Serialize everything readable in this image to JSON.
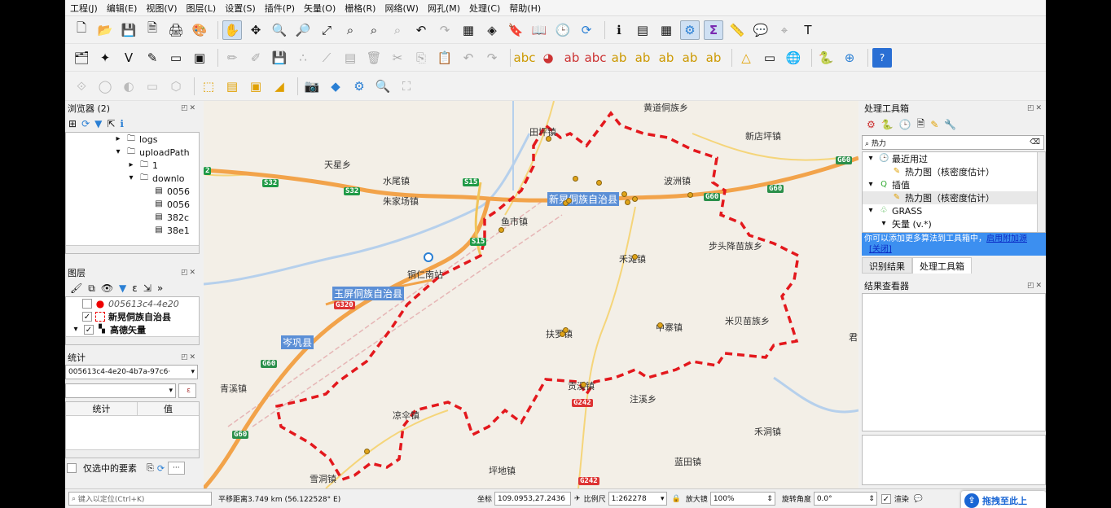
{
  "menu": [
    "工程(J)",
    "编辑(E)",
    "视图(V)",
    "图层(L)",
    "设置(S)",
    "插件(P)",
    "矢量(O)",
    "栅格(R)",
    "网络(W)",
    "网孔(M)",
    "处理(C)",
    "帮助(H)"
  ],
  "browser": {
    "title": "浏览器 (2)",
    "items": [
      "logs",
      "uploadPath",
      "1",
      "downlo",
      "0056",
      "0056",
      "382c",
      "38e1"
    ]
  },
  "layers": {
    "title": "图层",
    "items": [
      "005613c4-4e20",
      "新晃侗族自治县",
      "高德矢量"
    ]
  },
  "stats": {
    "title": "统计",
    "layer_value": "005613c4-4e20-4b7a-97c6·",
    "col_stat": "统计",
    "col_value": "值",
    "selected_only": "仅选中的要素",
    "more": "···"
  },
  "map": {
    "towns": [
      {
        "t": "天星乡"
      },
      {
        "t": "水尾镇"
      },
      {
        "t": "朱家场镇"
      },
      {
        "t": "田坪镇"
      },
      {
        "t": "新店坪镇"
      },
      {
        "t": "波洲镇"
      },
      {
        "t": "鱼市镇"
      },
      {
        "t": "步头降苗族乡"
      },
      {
        "t": "禾滩镇"
      },
      {
        "t": "铜仁南站"
      },
      {
        "t": "中寨镇"
      },
      {
        "t": "米贝苗族乡"
      },
      {
        "t": "扶罗镇"
      },
      {
        "t": "贡溪镇"
      },
      {
        "t": "注溪乡"
      },
      {
        "t": "青溪镇"
      },
      {
        "t": "凉伞镇"
      },
      {
        "t": "禾洞镇"
      },
      {
        "t": "蓝田镇"
      },
      {
        "t": "雪洞镇"
      },
      {
        "t": "坪地镇"
      },
      {
        "t": "黄道侗族乡"
      },
      {
        "t": "君"
      }
    ],
    "counties": [
      {
        "t": "新晃侗族自治县"
      },
      {
        "t": "玉屏侗族自治县"
      },
      {
        "t": "岑巩县"
      }
    ],
    "shields": [
      {
        "t": "S32",
        "c": "sh-s"
      },
      {
        "t": "S32",
        "c": "sh-s"
      },
      {
        "t": "S15",
        "c": "sh-s"
      },
      {
        "t": "S15",
        "c": "sh-s"
      },
      {
        "t": "G60",
        "c": "sh-g"
      },
      {
        "t": "G60",
        "c": "sh-g"
      },
      {
        "t": "G60",
        "c": "sh-g"
      },
      {
        "t": "G60",
        "c": "sh-g"
      },
      {
        "t": "G60",
        "c": "sh-g"
      },
      {
        "t": "G320",
        "c": "sh-r"
      },
      {
        "t": "G242",
        "c": "sh-r"
      },
      {
        "t": "G242",
        "c": "sh-r"
      },
      {
        "t": "2",
        "c": "sh-s"
      }
    ]
  },
  "toolbox": {
    "title": "处理工具箱",
    "search": "热力",
    "recent": "最近用过",
    "recent_item": "热力图（核密度估计）",
    "interp": "插值",
    "interp_item": "热力图（核密度估计）",
    "grass": "GRASS",
    "vector": "矢量 (v.*)",
    "notice": "你可以添加更多算法到工具箱中，",
    "notice_link": "启用附加源",
    "close_link": "[关闭]",
    "tab1": "识别结果",
    "tab2": "处理工具箱",
    "results_title": "结果查看器"
  },
  "status": {
    "locate_placeholder": "键入以定位(Ctrl+K)",
    "pan_info": "平移距离3.749 km (56.122528° E)",
    "coord_label": "坐标",
    "coord": "109.0953,27.2436",
    "scale_label": "比例尺",
    "scale": "1:262278",
    "magnifier_label": "放大镜",
    "magnifier": "100%",
    "rotation_label": "旋转角度",
    "rotation": "0.0°",
    "render": "渲染",
    "popup": "拖拽至此上"
  }
}
